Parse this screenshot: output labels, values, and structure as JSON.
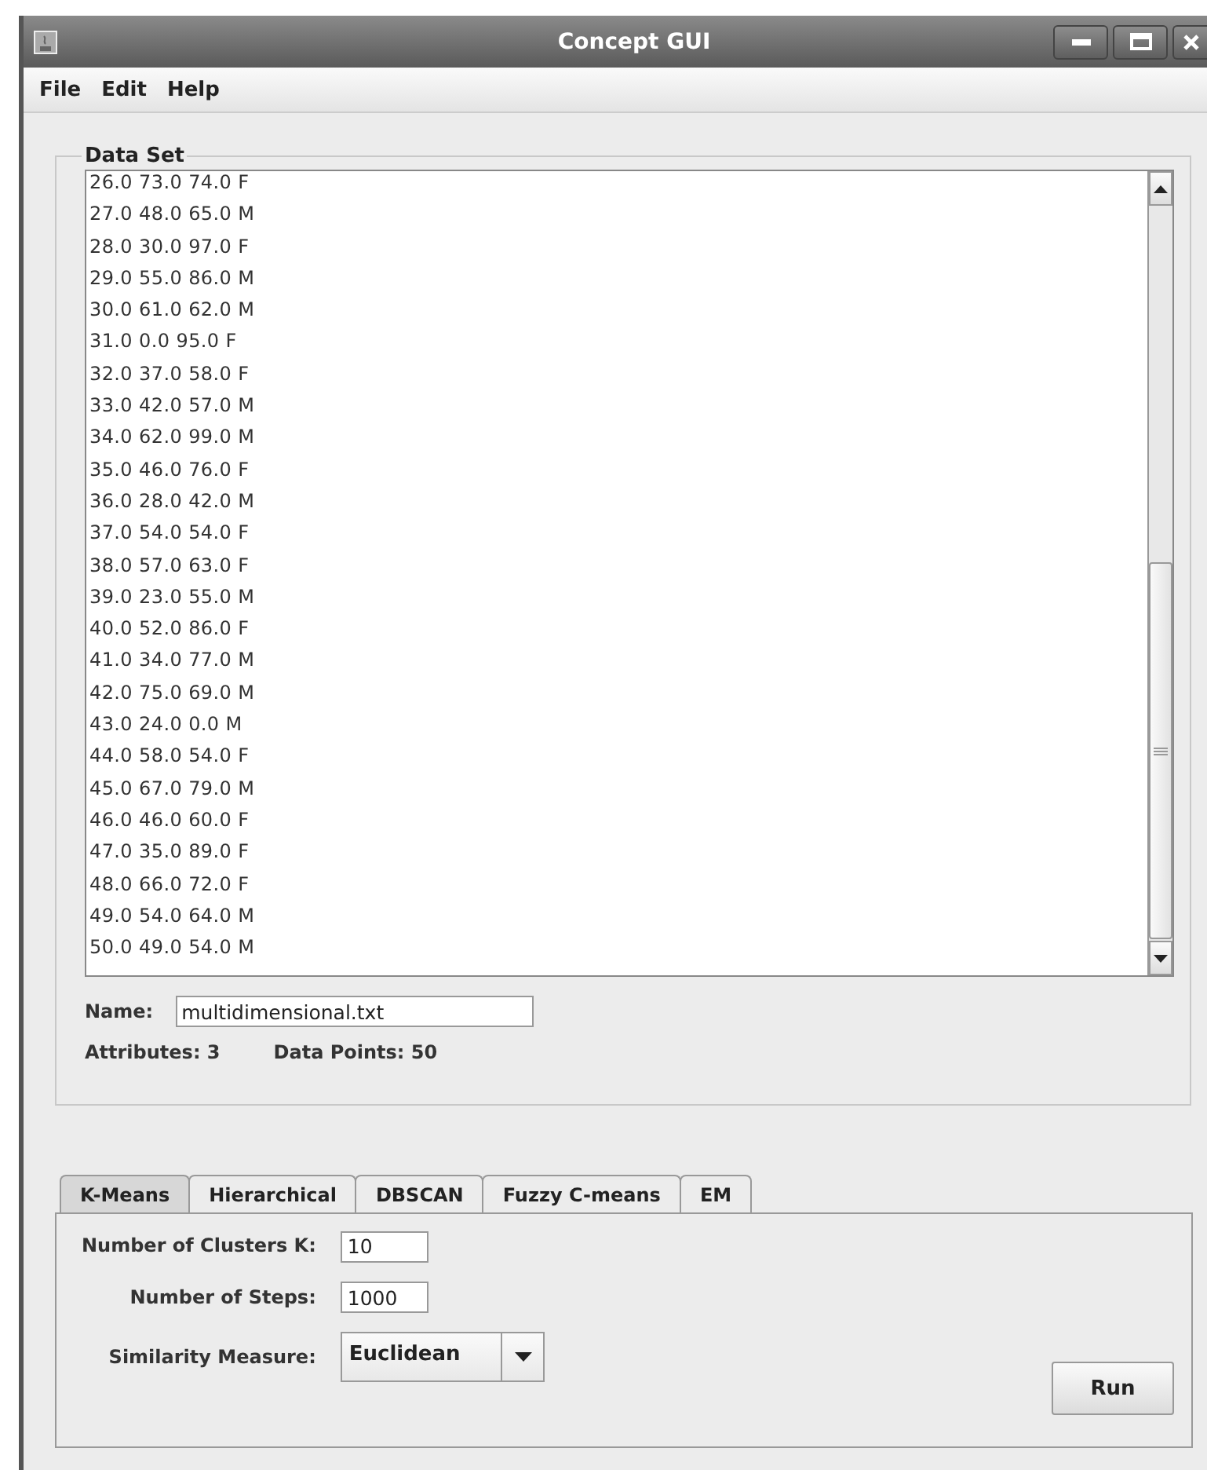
{
  "window": {
    "title": "Concept GUI"
  },
  "menu": [
    "File",
    "Edit",
    "Help"
  ],
  "data_set": {
    "title": "Data Set",
    "rows": [
      "26.0 73.0 74.0 F",
      "27.0 48.0 65.0 M",
      "28.0 30.0 97.0 F",
      "29.0 55.0 86.0 M",
      "30.0 61.0 62.0 M",
      "31.0 0.0 95.0 F",
      "32.0 37.0 58.0 F",
      "33.0 42.0 57.0 M",
      "34.0 62.0 99.0 M",
      "35.0 46.0 76.0 F",
      "36.0 28.0 42.0 M",
      "37.0 54.0 54.0 F",
      "38.0 57.0 63.0 F",
      "39.0 23.0 55.0 M",
      "40.0 52.0 86.0 F",
      "41.0 34.0 77.0 M",
      "42.0 75.0 69.0 M",
      "43.0 24.0 0.0 M",
      "44.0 58.0 54.0 F",
      "45.0 67.0 79.0 M",
      "46.0 46.0 60.0 F",
      "47.0 35.0 89.0 F",
      "48.0 66.0 72.0 F",
      "49.0 54.0 64.0 M",
      "50.0 49.0 54.0 M"
    ],
    "name_label": "Name:",
    "name_value": "multidimensional.txt",
    "attributes": "Attributes: 3",
    "data_points": "Data Points: 50"
  },
  "tabs": [
    {
      "label": "K-Means",
      "selected": true
    },
    {
      "label": "Hierarchical",
      "selected": false
    },
    {
      "label": "DBSCAN",
      "selected": false
    },
    {
      "label": "Fuzzy C-means",
      "selected": false
    },
    {
      "label": "EM",
      "selected": false
    }
  ],
  "kmeans": {
    "fields": [
      {
        "kind": "text",
        "label": "Number of Clusters K:",
        "value": "10"
      },
      {
        "kind": "text",
        "label": "Number of Steps:",
        "value": "1000"
      },
      {
        "kind": "dropdown",
        "label": "Similarity Measure:",
        "value": "Euclidean"
      }
    ],
    "run": "Run"
  }
}
